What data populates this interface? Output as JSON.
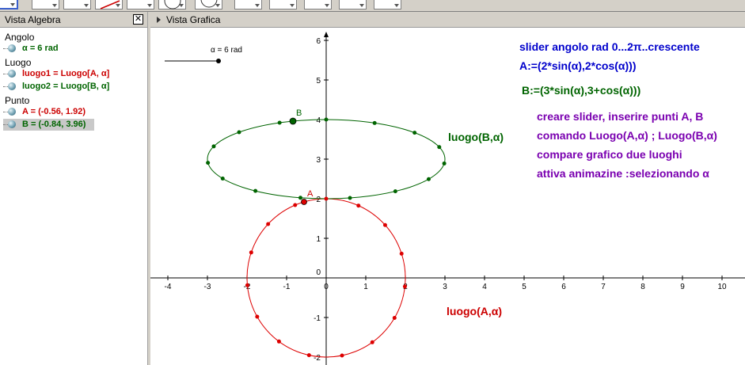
{
  "algebra": {
    "title": "Vista Algebra",
    "close_glyph": "✕",
    "groups": [
      {
        "label": "Angolo",
        "items": [
          {
            "text": "α = 6 rad",
            "color": "#006400"
          }
        ]
      },
      {
        "label": "Luogo",
        "items": [
          {
            "text": "luogo1 = Luogo[A, α]",
            "color": "#cc0000"
          },
          {
            "text": "luogo2 = Luogo[B, α]",
            "color": "#006400"
          }
        ]
      },
      {
        "label": "Punto",
        "items": [
          {
            "text": "A = (-0.56, 1.92)",
            "color": "#cc0000"
          },
          {
            "text": "B = (-0.84, 3.96)",
            "color": "#006400"
          }
        ]
      }
    ]
  },
  "graphics": {
    "title": "Vista Grafica",
    "slider_label": "α = 6 rad",
    "point_a_label": "A",
    "point_b_label": "B",
    "notes": [
      "slider angolo rad 0...2π..crescente",
      "A:=(2*sin(α),2*cos(α)))",
      "B:=(3*sin(α),3+cos(α)))",
      "creare slider, inserire punti A, B",
      "comando Luogo(A,α) ; Luogo(B,α)",
      "compare grafico due luoghi",
      "attiva animazine :selezionando α"
    ],
    "locus_b_label": "luogo(B,α)",
    "locus_a_label": "luogo(A,α)",
    "x_ticks": [
      "-4",
      "-3",
      "-2",
      "-1",
      "0",
      "1",
      "2",
      "3",
      "4",
      "5",
      "6",
      "7",
      "8",
      "9",
      "10"
    ],
    "y_ticks": [
      "6",
      "5",
      "4",
      "3",
      "2",
      "1",
      "0",
      "-1",
      "-2"
    ]
  },
  "colors": {
    "red": "#dd0000",
    "green": "#006400",
    "blue_note": "#0000cc",
    "purple_note": "#7a00b0",
    "label_red": "#cc0000"
  }
}
